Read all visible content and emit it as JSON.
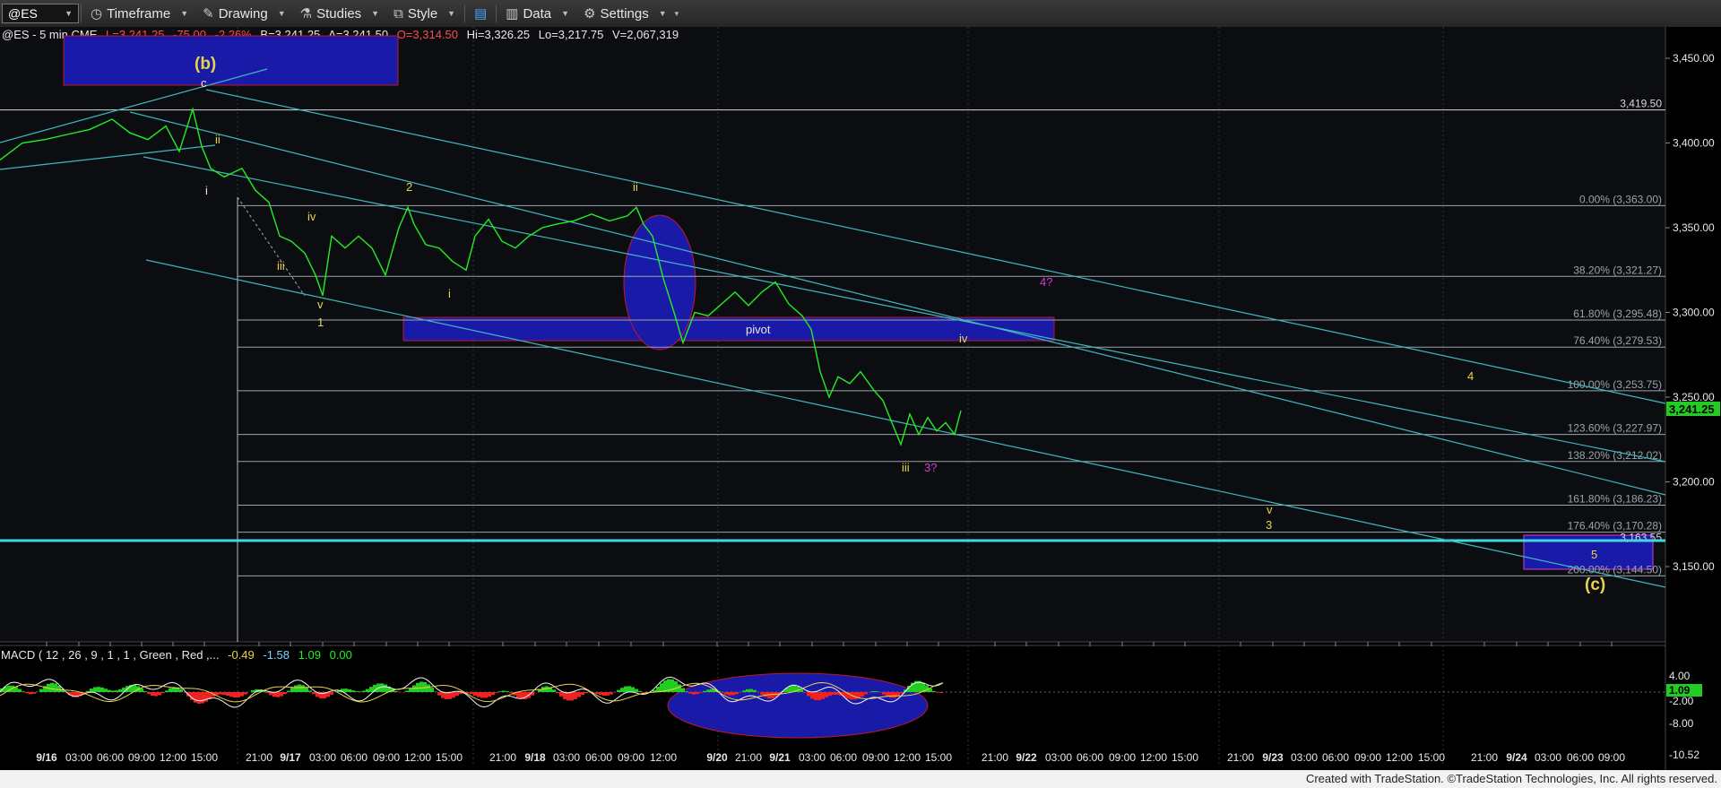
{
  "toolbar": {
    "symbol": "@ES",
    "timeframe": "Timeframe",
    "drawing": "Drawing",
    "studies": "Studies",
    "style": "Style",
    "data": "Data",
    "settings": "Settings"
  },
  "header": {
    "symbol_line": "@ES - 5 min  CME",
    "last": "L=3,241.25",
    "change": "-75.00",
    "change_pct": "-2.26%",
    "bid": "B=3,241.25",
    "ask": "A=3,241.50",
    "open": "O=3,314.50",
    "high": "Hi=3,326.25",
    "low": "Lo=3,217.75",
    "volume": "V=2,067,319"
  },
  "macd_header": {
    "label": "MACD ( 12 , 26 , 9 , 1 , 1 , Green , Red ,...",
    "v1": "-0.49",
    "v2": "-1.58",
    "v3": "1.09",
    "v4": "0.00"
  },
  "footer": "Created with TradeStation. ©TradeStation Technologies, Inc. All rights reserved.",
  "colors": {
    "price": "#22ee22",
    "channel": "#3fb8c0",
    "wave_yellow": "#e8d44a",
    "wave_magenta": "#d43bd4",
    "blue_box": "#1a1aa8",
    "red_outline": "#c0182a",
    "last_price_tag": "#22cc22"
  },
  "chart_data": {
    "type": "line",
    "title": "@ES - 5 min CME",
    "yaxis_ticks": [
      "3,450.00",
      "3,400.00",
      "3,350.00",
      "3,300.00",
      "3,250.00",
      "3,200.00",
      "3,150.00"
    ],
    "ylim": [
      3130,
      3463
    ],
    "last_price_tag": "3,241.25",
    "x_ticks": [
      {
        "label": "9/16",
        "bold": true
      },
      {
        "label": "03:00"
      },
      {
        "label": "06:00"
      },
      {
        "label": "09:00"
      },
      {
        "label": "12:00"
      },
      {
        "label": "15:00"
      },
      {
        "label": "21:00"
      },
      {
        "label": "9/17",
        "bold": true
      },
      {
        "label": "03:00"
      },
      {
        "label": "06:00"
      },
      {
        "label": "09:00"
      },
      {
        "label": "12:00"
      },
      {
        "label": "15:00"
      },
      {
        "label": "21:00"
      },
      {
        "label": "9/18",
        "bold": true
      },
      {
        "label": "03:00"
      },
      {
        "label": "06:00"
      },
      {
        "label": "09:00"
      },
      {
        "label": "12:00"
      },
      {
        "label": "9/20",
        "bold": true
      },
      {
        "label": "21:00"
      },
      {
        "label": "9/21",
        "bold": true
      },
      {
        "label": "03:00"
      },
      {
        "label": "06:00"
      },
      {
        "label": "09:00"
      },
      {
        "label": "12:00"
      },
      {
        "label": "15:00"
      },
      {
        "label": "21:00"
      },
      {
        "label": "9/22",
        "bold": true
      },
      {
        "label": "03:00"
      },
      {
        "label": "06:00"
      },
      {
        "label": "09:00"
      },
      {
        "label": "12:00"
      },
      {
        "label": "15:00"
      },
      {
        "label": "21:00"
      },
      {
        "label": "9/23",
        "bold": true
      },
      {
        "label": "03:00"
      },
      {
        "label": "06:00"
      },
      {
        "label": "09:00"
      },
      {
        "label": "12:00"
      },
      {
        "label": "15:00"
      },
      {
        "label": "21:00"
      },
      {
        "label": "9/24",
        "bold": true
      },
      {
        "label": "03:00"
      },
      {
        "label": "06:00"
      },
      {
        "label": "09:00"
      }
    ],
    "price_series": [
      [
        0,
        3390
      ],
      [
        25,
        3400
      ],
      [
        50,
        3402
      ],
      [
        75,
        3405
      ],
      [
        100,
        3408
      ],
      [
        125,
        3414
      ],
      [
        145,
        3406
      ],
      [
        165,
        3402
      ],
      [
        185,
        3410
      ],
      [
        200,
        3395
      ],
      [
        215,
        3420
      ],
      [
        225,
        3398
      ],
      [
        235,
        3385
      ],
      [
        250,
        3380
      ],
      [
        270,
        3385
      ],
      [
        285,
        3372
      ],
      [
        300,
        3365
      ],
      [
        312,
        3345
      ],
      [
        325,
        3342
      ],
      [
        340,
        3335
      ],
      [
        352,
        3322
      ],
      [
        360,
        3310
      ],
      [
        370,
        3345
      ],
      [
        385,
        3338
      ],
      [
        400,
        3345
      ],
      [
        415,
        3338
      ],
      [
        430,
        3322
      ],
      [
        445,
        3350
      ],
      [
        455,
        3362
      ],
      [
        462,
        3352
      ],
      [
        475,
        3340
      ],
      [
        490,
        3338
      ],
      [
        505,
        3330
      ],
      [
        520,
        3325
      ],
      [
        530,
        3345
      ],
      [
        545,
        3355
      ],
      [
        560,
        3342
      ],
      [
        575,
        3338
      ],
      [
        590,
        3345
      ],
      [
        605,
        3350
      ],
      [
        620,
        3352
      ],
      [
        640,
        3354
      ],
      [
        660,
        3358
      ],
      [
        680,
        3354
      ],
      [
        700,
        3357
      ],
      [
        710,
        3362
      ],
      [
        718,
        3352
      ],
      [
        728,
        3345
      ],
      [
        740,
        3320
      ],
      [
        752,
        3300
      ],
      [
        762,
        3282
      ],
      [
        775,
        3300
      ],
      [
        790,
        3298
      ],
      [
        805,
        3305
      ],
      [
        820,
        3312
      ],
      [
        835,
        3304
      ],
      [
        850,
        3312
      ],
      [
        865,
        3318
      ],
      [
        880,
        3305
      ],
      [
        895,
        3298
      ],
      [
        905,
        3290
      ],
      [
        915,
        3265
      ],
      [
        925,
        3250
      ],
      [
        935,
        3262
      ],
      [
        948,
        3258
      ],
      [
        960,
        3265
      ],
      [
        975,
        3254
      ],
      [
        985,
        3248
      ],
      [
        995,
        3235
      ],
      [
        1005,
        3222
      ],
      [
        1015,
        3240
      ],
      [
        1025,
        3228
      ],
      [
        1035,
        3238
      ],
      [
        1045,
        3230
      ],
      [
        1055,
        3235
      ],
      [
        1065,
        3228
      ],
      [
        1072,
        3242
      ]
    ],
    "horizontal_levels": [
      {
        "label": "3,419.50",
        "value": 3419.5
      },
      {
        "label": "0.00% (3,363.00)",
        "value": 3363.0
      },
      {
        "label": "38.20% (3,321.27)",
        "value": 3321.27
      },
      {
        "label": "61.80% (3,295.48)",
        "value": 3295.48
      },
      {
        "label": "76.40% (3,279.53)",
        "value": 3279.53
      },
      {
        "label": "100.00% (3,253.75)",
        "value": 3253.75
      },
      {
        "label": "123.60% (3,227.97)",
        "value": 3227.97
      },
      {
        "label": "138.20% (3,212.02)",
        "value": 3212.02
      },
      {
        "label": "161.80% (3,186.23)",
        "value": 3186.23
      },
      {
        "label": "176.40% (3,170.28)",
        "value": 3170.28
      },
      {
        "label": "3,163.55",
        "value": 3163.55
      },
      {
        "label": "200.00% (3,144.50)",
        "value": 3144.5
      }
    ],
    "wave_labels": [
      {
        "text": "(b)",
        "color": "yellow"
      },
      {
        "text": "c",
        "color": "white"
      },
      {
        "text": "ii",
        "color": "yellow"
      },
      {
        "text": "i",
        "color": "white"
      },
      {
        "text": "iv",
        "color": "yellow"
      },
      {
        "text": "iii",
        "color": "yellow"
      },
      {
        "text": "v",
        "color": "yellow"
      },
      {
        "text": "1",
        "color": "yellow"
      },
      {
        "text": "2",
        "color": "yellow"
      },
      {
        "text": "i",
        "color": "yellow"
      },
      {
        "text": "ii",
        "color": "yellow"
      },
      {
        "text": "iv",
        "color": "yellow"
      },
      {
        "text": "iii",
        "color": "yellow"
      },
      {
        "text": "3?",
        "color": "magenta"
      },
      {
        "text": "4?",
        "color": "magenta"
      },
      {
        "text": "4",
        "color": "yellow"
      },
      {
        "text": "v",
        "color": "yellow"
      },
      {
        "text": "3",
        "color": "yellow"
      },
      {
        "text": "5",
        "color": "yellow"
      },
      {
        "text": "(c)",
        "color": "yellow"
      },
      {
        "text": "pivot",
        "color": "white"
      }
    ],
    "macd_yaxis": [
      "4.00",
      "1.09",
      "-2.00",
      "-8.00",
      "-10.52"
    ]
  }
}
